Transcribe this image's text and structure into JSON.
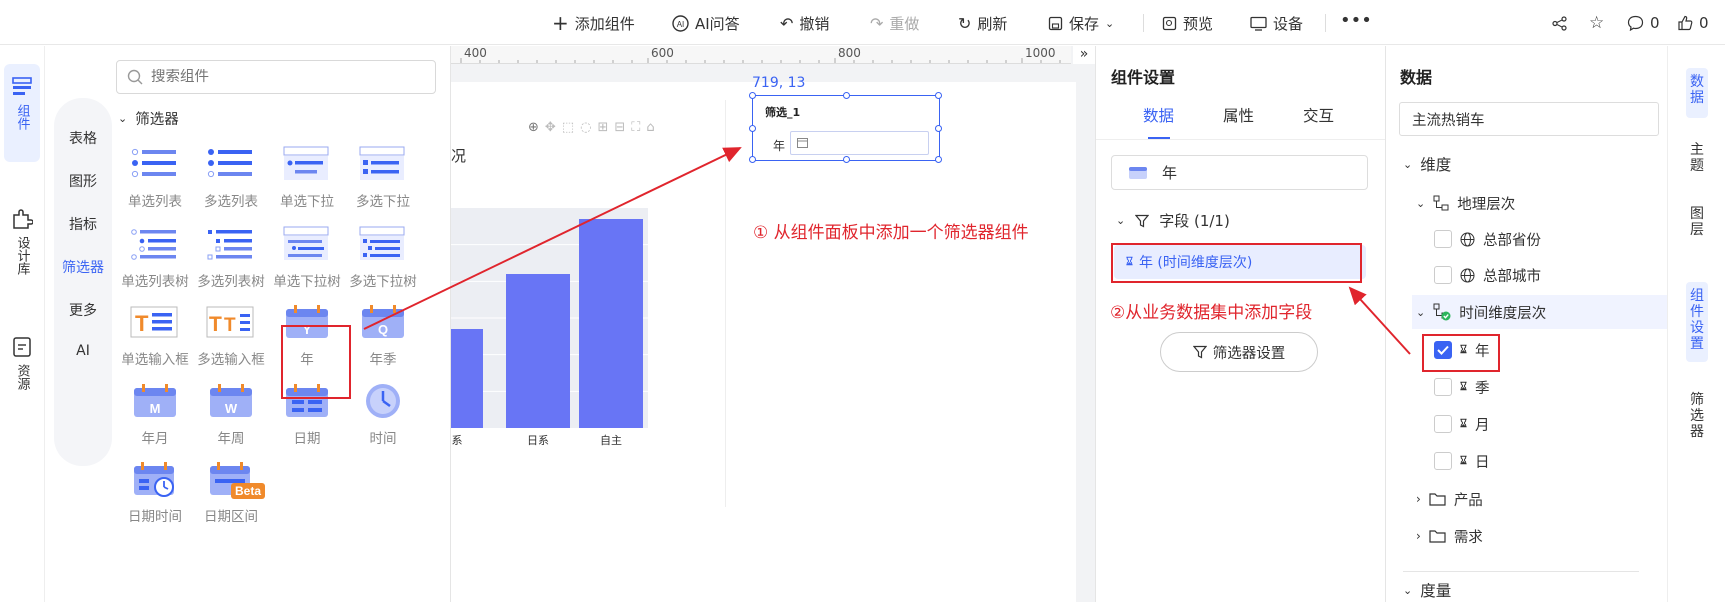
{
  "toolbar": {
    "add_component": "添加组件",
    "ai_qa": "AI问答",
    "undo": "撤销",
    "redo": "重做",
    "refresh": "刷新",
    "save": "保存",
    "preview": "预览",
    "device": "设备",
    "comment_count": "0",
    "like_count": "0"
  },
  "left_rail": {
    "components": "组件",
    "design_lib": "设计库",
    "resources": "资源"
  },
  "panel": {
    "search_placeholder": "搜索组件",
    "categories": [
      "表格",
      "图形",
      "指标",
      "筛选器",
      "更多",
      "AI"
    ],
    "section_title": "筛选器",
    "components": [
      "单选列表",
      "多选列表",
      "单选下拉",
      "多选下拉",
      "单选列表树",
      "多选列表树",
      "单选下拉树",
      "多选下拉树",
      "单选输入框",
      "多选输入框",
      "年",
      "年季",
      "年月",
      "年周",
      "日期",
      "时间",
      "日期时间",
      "日期区间"
    ],
    "beta": "Beta"
  },
  "canvas": {
    "ruler": [
      "400",
      "600",
      "800",
      "1000"
    ],
    "coords": "719, 13",
    "filter_title": "筛选_1",
    "filter_label": "年",
    "chart_title_fragment": "况",
    "chart_data": {
      "type": "bar",
      "categories": [
        "系",
        "日系",
        "自主"
      ],
      "values": [
        0.45,
        0.7,
        0.95
      ],
      "title": "",
      "xlabel": "",
      "ylabel": ""
    }
  },
  "annotations": {
    "step1": "① 从组件面板中添加一个筛选器组件",
    "step2": "②从业务数据集中添加字段"
  },
  "settings": {
    "title": "组件设置",
    "tabs": [
      "数据",
      "属性",
      "交互"
    ],
    "field_value": "年",
    "fields_header": "字段 (1/1)",
    "field_chip": "年 (时间维度层次)",
    "filter_settings_button": "筛选器设置"
  },
  "data_panel": {
    "title": "数据",
    "dataset": "主流热销车",
    "dimension": "维度",
    "geo_hierarchy": "地理层次",
    "hq_province": "总部省份",
    "hq_city": "总部城市",
    "time_hierarchy": "时间维度层次",
    "year": "年",
    "quarter": "季",
    "month": "月",
    "day": "日",
    "product": "产品",
    "demand": "需求",
    "measure": "度量"
  },
  "right_rail": {
    "data": "数据",
    "theme": "主题",
    "layer": "图层",
    "component_settings": "组件设置",
    "filter": "筛选器"
  },
  "colors": {
    "accent": "#3a63f3",
    "bar": "#6875f5",
    "annotation": "#e0252d"
  }
}
